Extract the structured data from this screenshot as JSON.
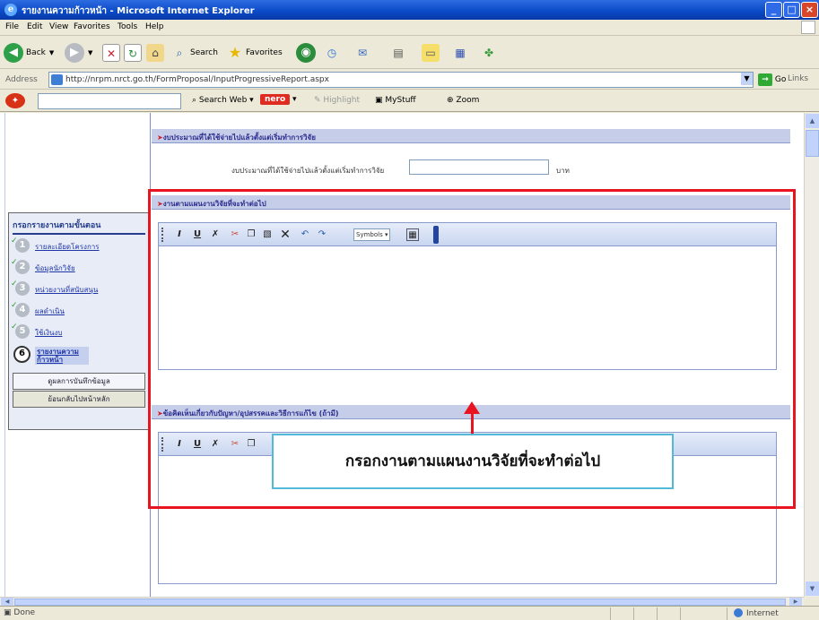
{
  "window": {
    "title": "รายงานความก้าวหน้า - Microsoft Internet Explorer",
    "controls": {
      "minimize": "_",
      "maximize": "□",
      "close": "×"
    }
  },
  "menu": [
    "File",
    "Edit",
    "View",
    "Favorites",
    "Tools",
    "Help"
  ],
  "toolbar": {
    "back": "Back",
    "search": "Search",
    "favorites": "Favorites"
  },
  "address": {
    "label": "Address",
    "url": "http://nrpm.nrct.go.th/FormProposal/InputProgressiveReport.aspx",
    "go": "Go",
    "links": "Links"
  },
  "searchbar": {
    "search_web": "Search Web",
    "brand": "nero",
    "highlight": "Highlight",
    "mystuff": "MyStuff",
    "zoom": "Zoom"
  },
  "sidebar": {
    "heading": "กรอกรายงานตามขั้นตอน",
    "steps": [
      {
        "number": "1",
        "label": "รายละเอียดโครงการ",
        "done": true
      },
      {
        "number": "2",
        "label": "ข้อมูลนักวิจัย",
        "done": true
      },
      {
        "number": "3",
        "label": "หน่วยงานที่สนับสนุน",
        "done": true
      },
      {
        "number": "4",
        "label": "ผลดำเนิน",
        "done": true
      },
      {
        "number": "5",
        "label": "ใช้เงินงบ",
        "done": true
      },
      {
        "number": "6",
        "label": "รายงานความก้าวหน้า",
        "done": false
      }
    ],
    "buttons": [
      "ดูผลการบันทึกข้อมูล",
      "ย้อนกลับไปหน้าหลัก"
    ]
  },
  "sections": {
    "budget": {
      "header": "งบประมาณที่ได้ใช้จ่ายไปแล้วตั้งแต่เริ่มทำการวิจัย",
      "label": "งบประมาณที่ได้ใช้จ่ายไปแล้วตั้งแต่เริ่มทำการวิจัย",
      "value": "",
      "unit": "บาท"
    },
    "plan": {
      "header": "งานตามแผนงานวิจัยที่จะทำต่อไป"
    },
    "problems": {
      "header": "ข้อคิดเห็นเกี่ยวกับปัญหา/อุปสรรคและวิธีการแก้ไข (ถ้ามี)"
    }
  },
  "editor_toolbar": {
    "italic": "I",
    "underline": "U",
    "symbols": "Symbols"
  },
  "annotation": {
    "callout": "กรอกงานตามแผนงานวิจัยที่จะทำต่อไป",
    "color": "#E8141F"
  },
  "status": {
    "left": "Done",
    "zone": "Internet"
  }
}
